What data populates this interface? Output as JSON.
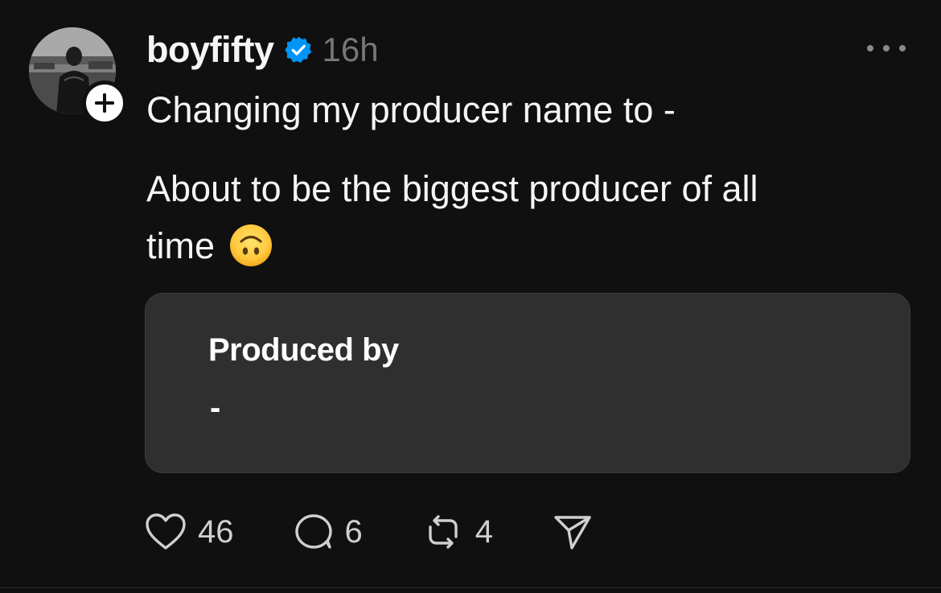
{
  "post": {
    "username": "boyfifty",
    "verified": true,
    "timestamp": "16h",
    "text_line1": "Changing my producer name to -",
    "text_line2": "About to be the biggest producer of all",
    "text_line3": "time",
    "emoji": "upside-down-face",
    "card": {
      "title": "Produced by",
      "value": "-"
    },
    "actions": {
      "likes": "46",
      "replies": "6",
      "reposts": "4"
    }
  },
  "icons": {
    "verified": "verified-check-icon",
    "more": "more-dots-icon",
    "follow": "plus-icon",
    "like": "heart-icon",
    "reply": "comment-bubble-icon",
    "repost": "repost-icon",
    "share": "send-icon"
  },
  "colors": {
    "background": "#101010",
    "text": "#f3f5f7",
    "muted": "#777777",
    "verified": "#0095f6",
    "card_background": "#2f2f2f"
  }
}
